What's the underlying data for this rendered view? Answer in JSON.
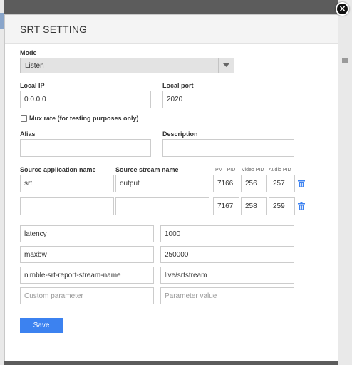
{
  "modal": {
    "title": "SRT SETTING",
    "close_symbol": "×"
  },
  "mode": {
    "label": "Mode",
    "value": "Listen",
    "arrow_icon": "triangle-down"
  },
  "local_ip": {
    "label": "Local IP",
    "value": "0.0.0.0"
  },
  "local_port": {
    "label": "Local port",
    "value": "2020"
  },
  "mux_rate": {
    "label": "Mux rate (for testing purposes only)",
    "checked": false
  },
  "alias": {
    "label": "Alias",
    "value": ""
  },
  "description": {
    "label": "Description",
    "value": ""
  },
  "streams": {
    "headers": {
      "source_app": "Source application name",
      "source_stream": "Source stream name",
      "pmt_pid": "PMT PID",
      "video_pid": "Video PID",
      "audio_pid": "Audio PID"
    },
    "rows": [
      {
        "app": "srt",
        "stream": "output",
        "pmt": "7166",
        "video": "256",
        "audio": "257"
      },
      {
        "app": "",
        "stream": "",
        "pmt": "7167",
        "video": "258",
        "audio": "259"
      }
    ]
  },
  "params": [
    {
      "name": "latency",
      "value": "1000"
    },
    {
      "name": "maxbw",
      "value": "250000"
    },
    {
      "name": "nimble-srt-report-stream-name",
      "value": "live/srtstream"
    }
  ],
  "new_param": {
    "name_placeholder": "Custom parameter",
    "value_placeholder": "Parameter value"
  },
  "save_label": "Save",
  "colors": {
    "accent": "#3c82f0",
    "trash": "#3c82f0",
    "overlay": "#5c5c5c"
  }
}
